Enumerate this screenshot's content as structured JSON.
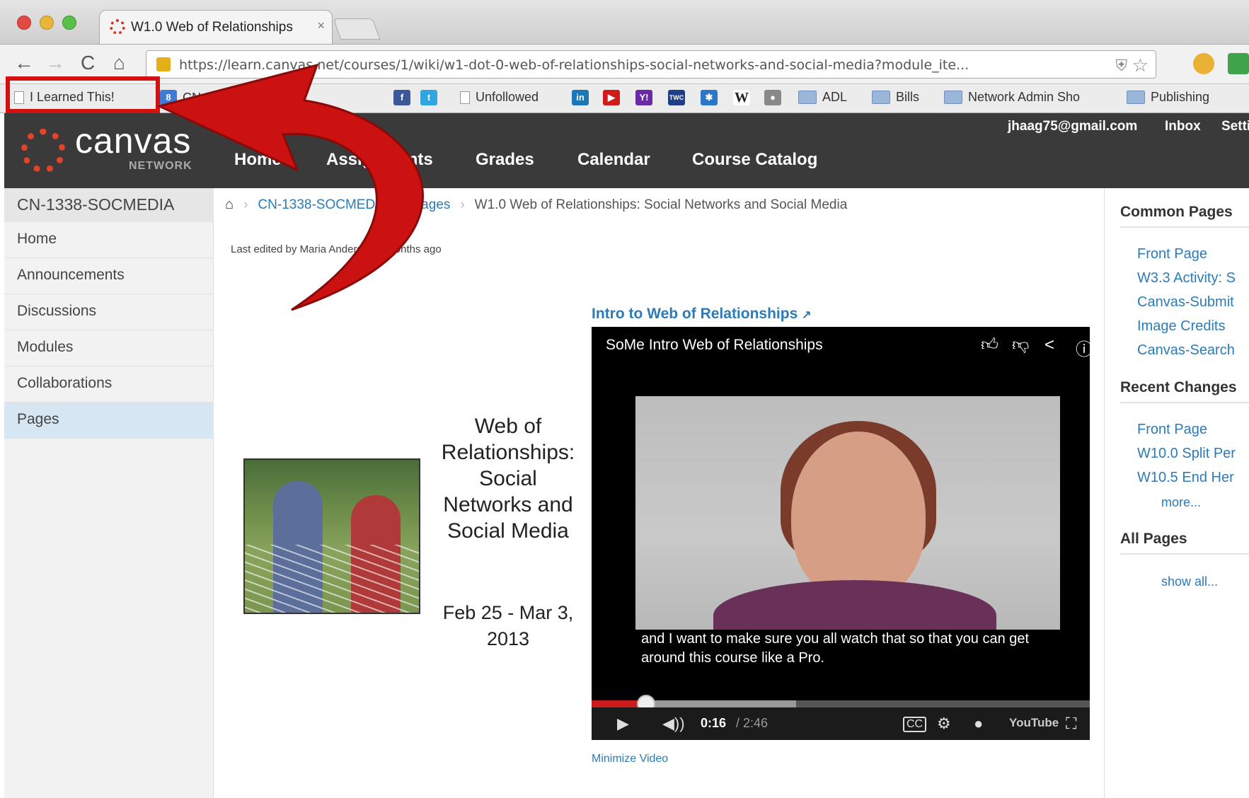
{
  "browser": {
    "tab_title": "W1.0 Web of Relationships",
    "tab_close": "×",
    "url": "https://learn.canvas.net/courses/1/wiki/w1-dot-0-web-of-relationships-social-networks-and-social-media?module_ite...",
    "nav": {
      "back": "←",
      "forward": "→",
      "reload": "C",
      "home": "⌂"
    },
    "bookmarks": [
      "I Learned This!",
      "CN",
      "Unfollowed",
      "ADL",
      "Bills",
      "Network Admin Sho",
      "Publishing"
    ]
  },
  "header": {
    "logo_text": "canvas",
    "logo_sub": "NETWORK",
    "nav": [
      "Home",
      "Assignments",
      "Grades",
      "Calendar",
      "Course Catalog"
    ],
    "user_email": "jhaag75@gmail.com",
    "inbox": "Inbox",
    "settings": "Settings"
  },
  "sidebar": {
    "course_code": "CN-1338-SOCMEDIA",
    "items": [
      "Home",
      "Announcements",
      "Discussions",
      "Modules",
      "Collaborations",
      "Pages"
    ],
    "active": "Pages"
  },
  "breadcrumb": {
    "course": "CN-1338-SOCMEDIA",
    "section": "Pages",
    "current": "W1.0 Web of Relationships: Social Networks and Social Media"
  },
  "page": {
    "last_edited": "Last edited by Maria Andersen 3 months ago",
    "title": "Web of Relationships: Social Networks and Social Media",
    "dates": "Feb 25 - Mar 3, 2013"
  },
  "video": {
    "link_text": "Intro to Web of Relationships",
    "title": "SoMe Intro Web of Relationships",
    "captions": "and I want to make sure you all watch that so that you can get around this course like a Pro.",
    "time_current": "0:16",
    "time_total": "/ 2:46",
    "progress": 0.11,
    "buffered": 0.41,
    "youtube": "YouTube",
    "minimize": "Minimize Video"
  },
  "right_column": {
    "common_heading": "Common Pages",
    "common_links": [
      "Front Page",
      "W3.3 Activity: S",
      "Canvas-Submit",
      "Image Credits",
      "Canvas-Search"
    ],
    "recent_heading": "Recent Changes",
    "recent_links": [
      "Front Page",
      "W10.0 Split Per",
      "W10.5 End Her"
    ],
    "recent_more": "more...",
    "all_heading": "All Pages",
    "all_link": "show all..."
  },
  "colors": {
    "annotation_red": "#d41111",
    "canvas_dark": "#3a3a3a",
    "link_blue": "#2b7bb9"
  }
}
